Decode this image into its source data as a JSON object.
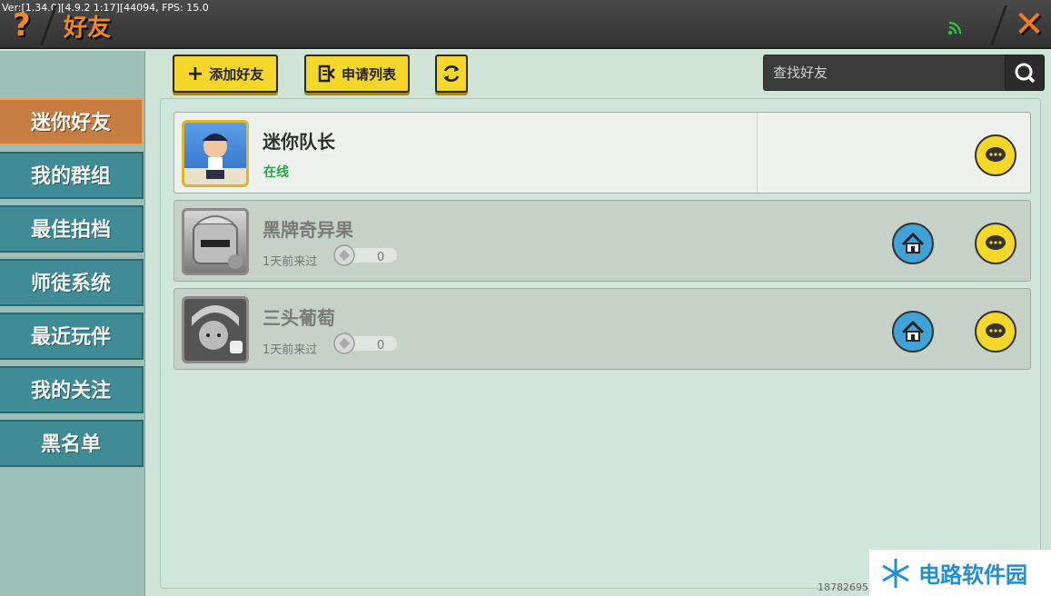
{
  "topbar": {
    "debug_text": "Ver:[1.34.0][4.9.2 1:17][44094,     FPS: 15.0",
    "help_glyph": "?",
    "title": "好友",
    "close_glyph": "✕"
  },
  "sidebar": {
    "items": [
      {
        "label": "迷你好友",
        "active": true
      },
      {
        "label": "我的群组",
        "active": false
      },
      {
        "label": "最佳拍档",
        "active": false
      },
      {
        "label": "师徒系统",
        "active": false
      },
      {
        "label": "最近玩伴",
        "active": false
      },
      {
        "label": "我的关注",
        "active": false
      },
      {
        "label": "黑名单",
        "active": false
      }
    ]
  },
  "toolbar": {
    "add_friend_icon": "+",
    "add_friend_label": "添加好友",
    "request_list_label": "申请列表",
    "search_placeholder": "查找好友"
  },
  "friends": [
    {
      "name": "迷你队长",
      "status": "在线",
      "online": true
    },
    {
      "name": "黑牌奇异果",
      "last_seen": "1天前来过",
      "gift_count": "0",
      "online": false
    },
    {
      "name": "三头葡萄",
      "last_seen": "1天前来过",
      "gift_count": "0",
      "online": false
    }
  ],
  "footer": {
    "uid": "18782695",
    "watermark": "电路软件园"
  },
  "colors": {
    "accent_orange": "#f08a1e",
    "active_tab": "#c87e42",
    "tab": "#3f8b96",
    "button_yellow": "#f5d72a",
    "online_green": "#2fa34a",
    "home_blue": "#3fa3d7"
  }
}
